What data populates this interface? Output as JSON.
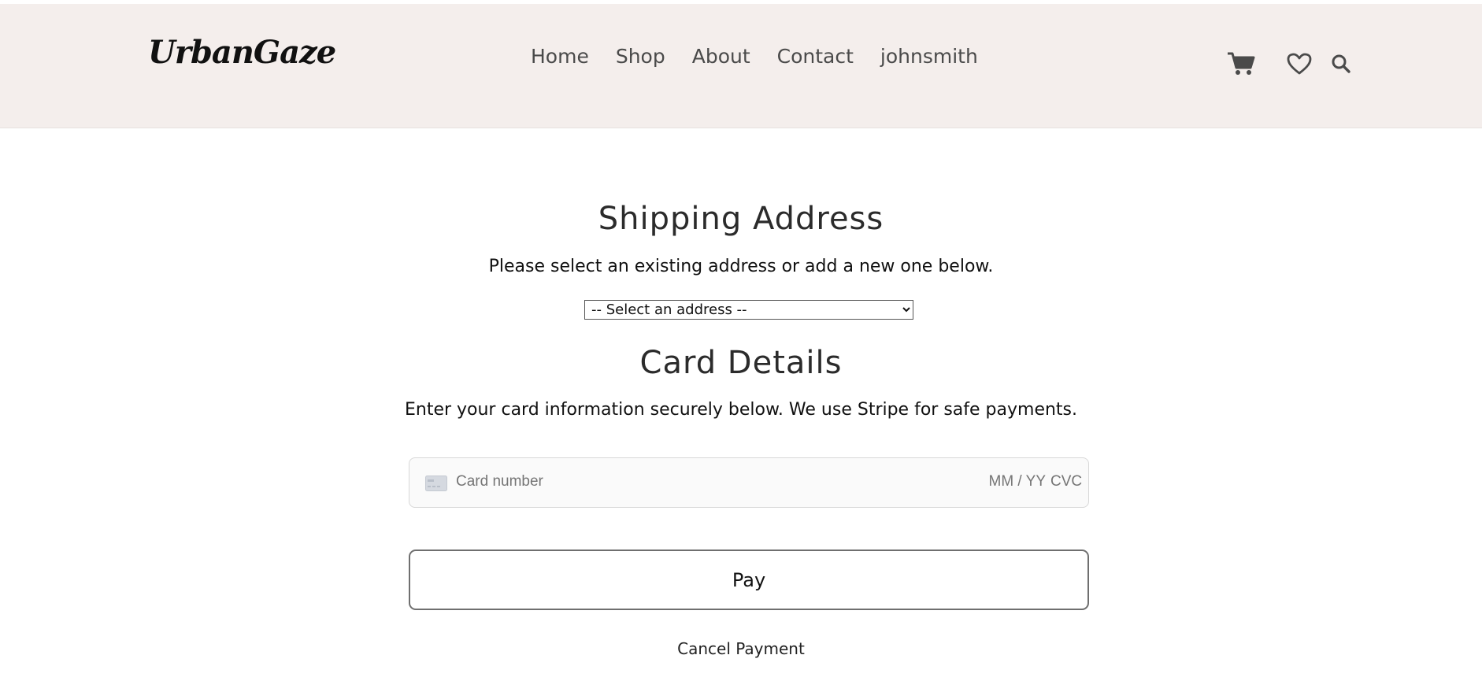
{
  "header": {
    "logo": "UrbanGaze",
    "nav": [
      "Home",
      "Shop",
      "About",
      "Contact",
      "johnsmith"
    ],
    "icons": [
      "cart-icon",
      "heart-icon",
      "search-icon"
    ]
  },
  "shipping": {
    "title": "Shipping Address",
    "subtitle": "Please select an existing address or add a new one below.",
    "select_value": "-- Select an address --"
  },
  "card": {
    "title": "Card Details",
    "subtitle": "Enter your card information securely below. We use Stripe for safe payments.",
    "number_placeholder": "Card number",
    "expiry_placeholder": "MM / YY",
    "cvc_placeholder": "CVC"
  },
  "actions": {
    "pay_label": "Pay",
    "cancel_label": "Cancel Payment"
  },
  "colors": {
    "header_bg": "#f4eeec",
    "text_dark": "#2b2b2b",
    "placeholder": "#888888"
  }
}
